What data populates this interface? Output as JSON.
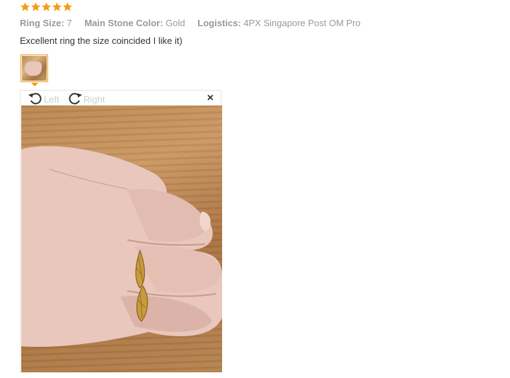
{
  "review": {
    "rating": 5,
    "rating_color": "#f39c12",
    "attributes": [
      {
        "label": "Ring Size:",
        "value": "7"
      },
      {
        "label": "Main Stone Color:",
        "value": "Gold"
      },
      {
        "label": "Logistics:",
        "value": "4PX Singapore Post OM Pro"
      }
    ],
    "text": "Excellent ring the size coincided I like it)"
  },
  "viewer": {
    "rotate_left_label": "Left",
    "rotate_right_label": "Right",
    "close_glyph": "×",
    "rotate_left_icon": "rotate-left-icon",
    "rotate_right_icon": "rotate-right-icon",
    "close_icon": "close-icon"
  }
}
